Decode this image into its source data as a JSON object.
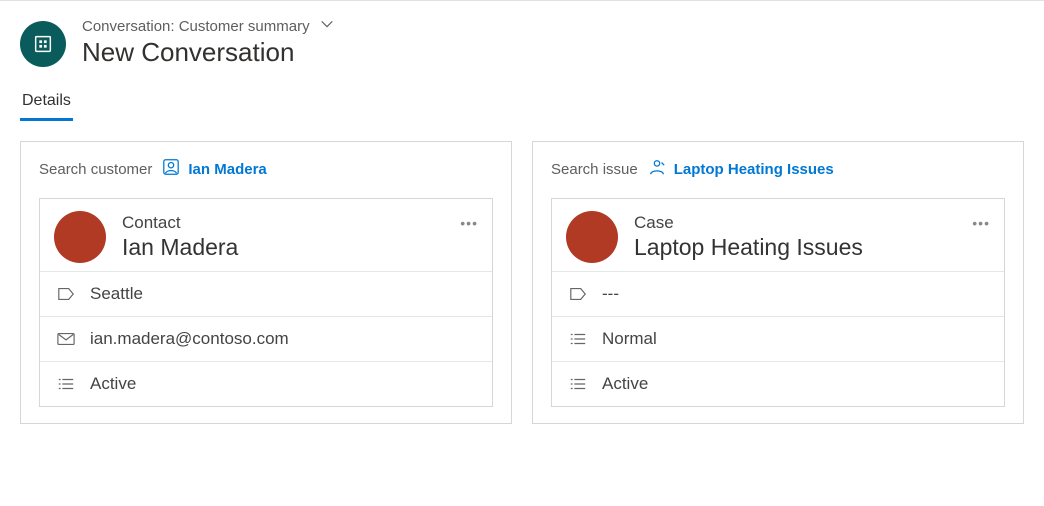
{
  "header": {
    "breadcrumb": "Conversation: Customer summary",
    "title": "New Conversation"
  },
  "tabs": {
    "details": "Details"
  },
  "customer_panel": {
    "search_label": "Search customer",
    "link": "Ian Madera",
    "card": {
      "type": "Contact",
      "title": "Ian Madera",
      "fields": {
        "location": "Seattle",
        "email": "ian.madera@contoso.com",
        "status": "Active"
      }
    }
  },
  "issue_panel": {
    "search_label": "Search issue",
    "link": "Laptop Heating Issues",
    "card": {
      "type": "Case",
      "title": "Laptop Heating Issues",
      "fields": {
        "location": "---",
        "priority": "Normal",
        "status": "Active"
      }
    }
  }
}
